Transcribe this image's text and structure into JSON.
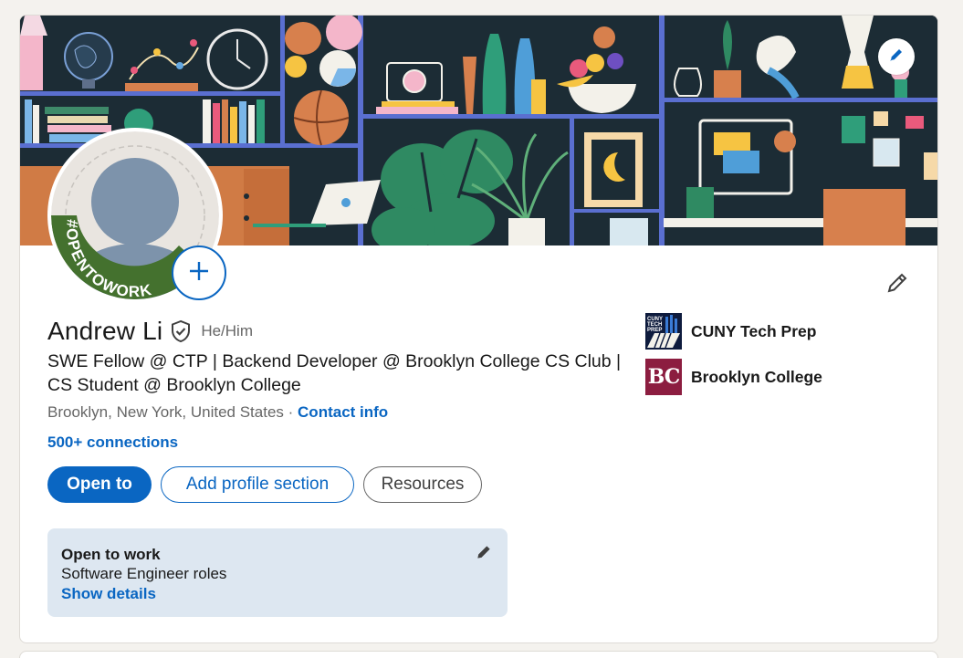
{
  "profile": {
    "name": "Andrew Li",
    "pronouns": "He/Him",
    "headline": "SWE Fellow @ CTP | Backend Developer @ Brooklyn College CS Club | CS Student @ Brooklyn College",
    "location": "Brooklyn, New York, United States",
    "location_separator": " · ",
    "contact_info": "Contact info",
    "connections": "500+ connections",
    "photo_badge": "#OPENTOWORK"
  },
  "buttons": {
    "open_to": "Open to",
    "add_profile_section": "Add profile section",
    "resources": "Resources"
  },
  "open_to_work": {
    "title": "Open to work",
    "roles": "Software Engineer roles",
    "show_details": "Show details"
  },
  "organizations": [
    {
      "name": "CUNY Tech Prep",
      "logo_text": "CUNY TECH PREP"
    },
    {
      "name": "Brooklyn College",
      "logo_text": "BC"
    }
  ],
  "colors": {
    "accent": "#0a66c2",
    "open_to_work_green": "#44712e",
    "open_to_work_card_bg": "#dde7f1",
    "bc_maroon": "#8c1d40"
  },
  "icons": {
    "cover_edit": "pencil-icon",
    "add_photo": "plus-icon",
    "intro_edit": "pencil-icon",
    "verified": "shield-check-icon",
    "open_to_work_edit": "pencil-icon"
  }
}
